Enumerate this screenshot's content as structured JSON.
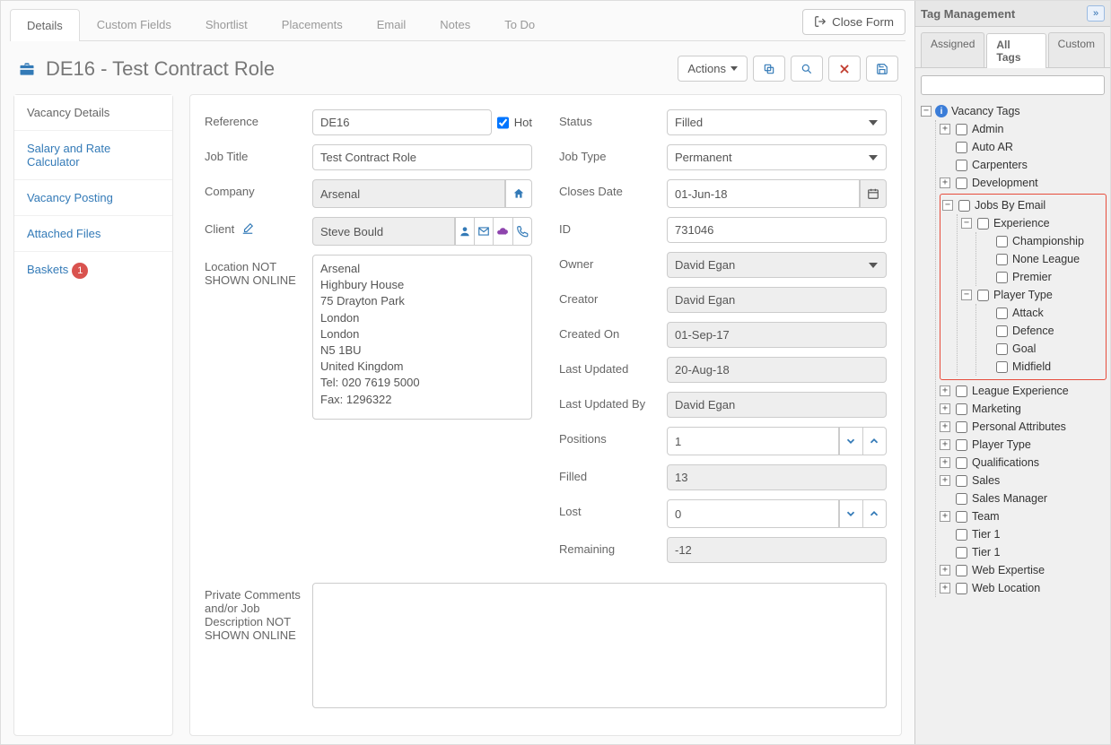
{
  "tabs": [
    "Details",
    "Custom Fields",
    "Shortlist",
    "Placements",
    "Email",
    "Notes",
    "To Do"
  ],
  "close_form": "Close Form",
  "title": "DE16 - Test Contract Role",
  "actions_label": "Actions",
  "left_nav": {
    "vacancy_details": "Vacancy Details",
    "salary": "Salary and Rate Calculator",
    "posting": "Vacancy Posting",
    "files": "Attached Files",
    "baskets": "Baskets",
    "baskets_count": "1"
  },
  "labels": {
    "reference": "Reference",
    "hot": "Hot",
    "job_title": "Job Title",
    "company": "Company",
    "client": "Client",
    "location": "Location NOT SHOWN ONLINE",
    "comments": "Private Comments and/or Job Description NOT SHOWN ONLINE",
    "status": "Status",
    "job_type": "Job Type",
    "closes": "Closes Date",
    "id": "ID",
    "owner": "Owner",
    "creator": "Creator",
    "created_on": "Created On",
    "last_updated": "Last Updated",
    "updated_by": "Last Updated By",
    "positions": "Positions",
    "filled": "Filled",
    "lost": "Lost",
    "remaining": "Remaining"
  },
  "values": {
    "reference": "DE16",
    "hot_checked": true,
    "job_title": "Test Contract Role",
    "company": "Arsenal",
    "client": "Steve Bould",
    "location": "Arsenal\nHighbury House\n75 Drayton Park\nLondon\nLondon\nN5 1BU\nUnited Kingdom\nTel: 020 7619 5000\nFax: 1296322",
    "status": "Filled",
    "job_type": "Permanent",
    "closes": "01-Jun-18",
    "id": "731046",
    "owner": "David Egan",
    "creator": "David Egan",
    "created_on": "01-Sep-17",
    "last_updated": "20-Aug-18",
    "updated_by": "David Egan",
    "positions": "1",
    "filled": "13",
    "lost": "0",
    "remaining": "-12",
    "comments": ""
  },
  "right": {
    "title": "Tag Management",
    "tabs": [
      "Assigned",
      "All Tags",
      "Custom"
    ],
    "root": "Vacancy Tags",
    "tags": {
      "admin": "Admin",
      "autoar": "Auto AR",
      "carpenters": "Carpenters",
      "development": "Development",
      "jobs": "Jobs By Email",
      "experience": "Experience",
      "championship": "Championship",
      "noneleague": "None League",
      "premier": "Premier",
      "playertype": "Player Type",
      "attack": "Attack",
      "defence": "Defence",
      "goal": "Goal",
      "midfield": "Midfield",
      "league": "League Experience",
      "marketing": "Marketing",
      "personal": "Personal Attributes",
      "playertype2": "Player Type",
      "qual": "Qualifications",
      "sales": "Sales",
      "salesmgr": "Sales Manager",
      "team": "Team",
      "tier1a": "Tier 1",
      "tier1b": "Tier 1",
      "web": "Web Expertise",
      "webloc": "Web Location"
    }
  }
}
